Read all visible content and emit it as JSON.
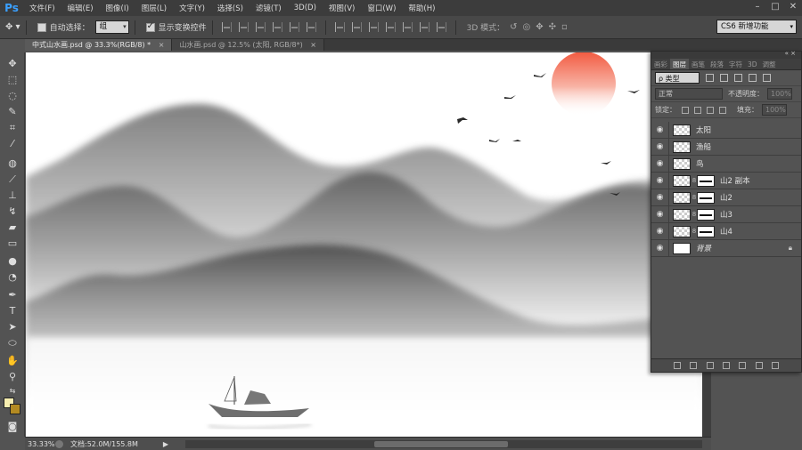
{
  "app": {
    "logo": "Ps"
  },
  "menu": [
    "文件(F)",
    "编辑(E)",
    "图像(I)",
    "图层(L)",
    "文字(Y)",
    "选择(S)",
    "滤镜(T)",
    "3D(D)",
    "视图(V)",
    "窗口(W)",
    "帮助(H)"
  ],
  "options": {
    "auto_select_label": "自动选择：",
    "auto_select_value": "组",
    "transform_label": "显示变换控件",
    "mode_3d_label": "3D 模式：",
    "workspace": "CS6 新增功能"
  },
  "tabs": [
    {
      "label": "中式山水画.psd @ 33.3%(RGB/8) *",
      "close": "×"
    },
    {
      "label": "山水画.psd @ 12.5% (太阳, RGB/8*)",
      "close": "×"
    }
  ],
  "panel": {
    "tabs": [
      "画彩",
      "图层",
      "画笔",
      "段落",
      "字符",
      "3D",
      "调整"
    ],
    "filter_kind": "ρ 类型",
    "blend_mode": "正常",
    "opacity_label": "不透明度：",
    "opacity_value": "100%",
    "lock_label": "锁定：",
    "fill_label": "填充：",
    "fill_value": "100%",
    "layers": [
      {
        "name": "太阳"
      },
      {
        "name": "渔船"
      },
      {
        "name": "鸟"
      },
      {
        "name": "山2 副本"
      },
      {
        "name": "山2"
      },
      {
        "name": "山3"
      },
      {
        "name": "山4"
      },
      {
        "name": "背景"
      }
    ]
  },
  "status": {
    "zoom": "33.33%",
    "doc": "文档:52.0M/155.8M",
    "arrow": "▶"
  },
  "colors": {
    "sun": "#f25a40",
    "foreground": "#f7eeb0",
    "background": "#b38a22"
  }
}
